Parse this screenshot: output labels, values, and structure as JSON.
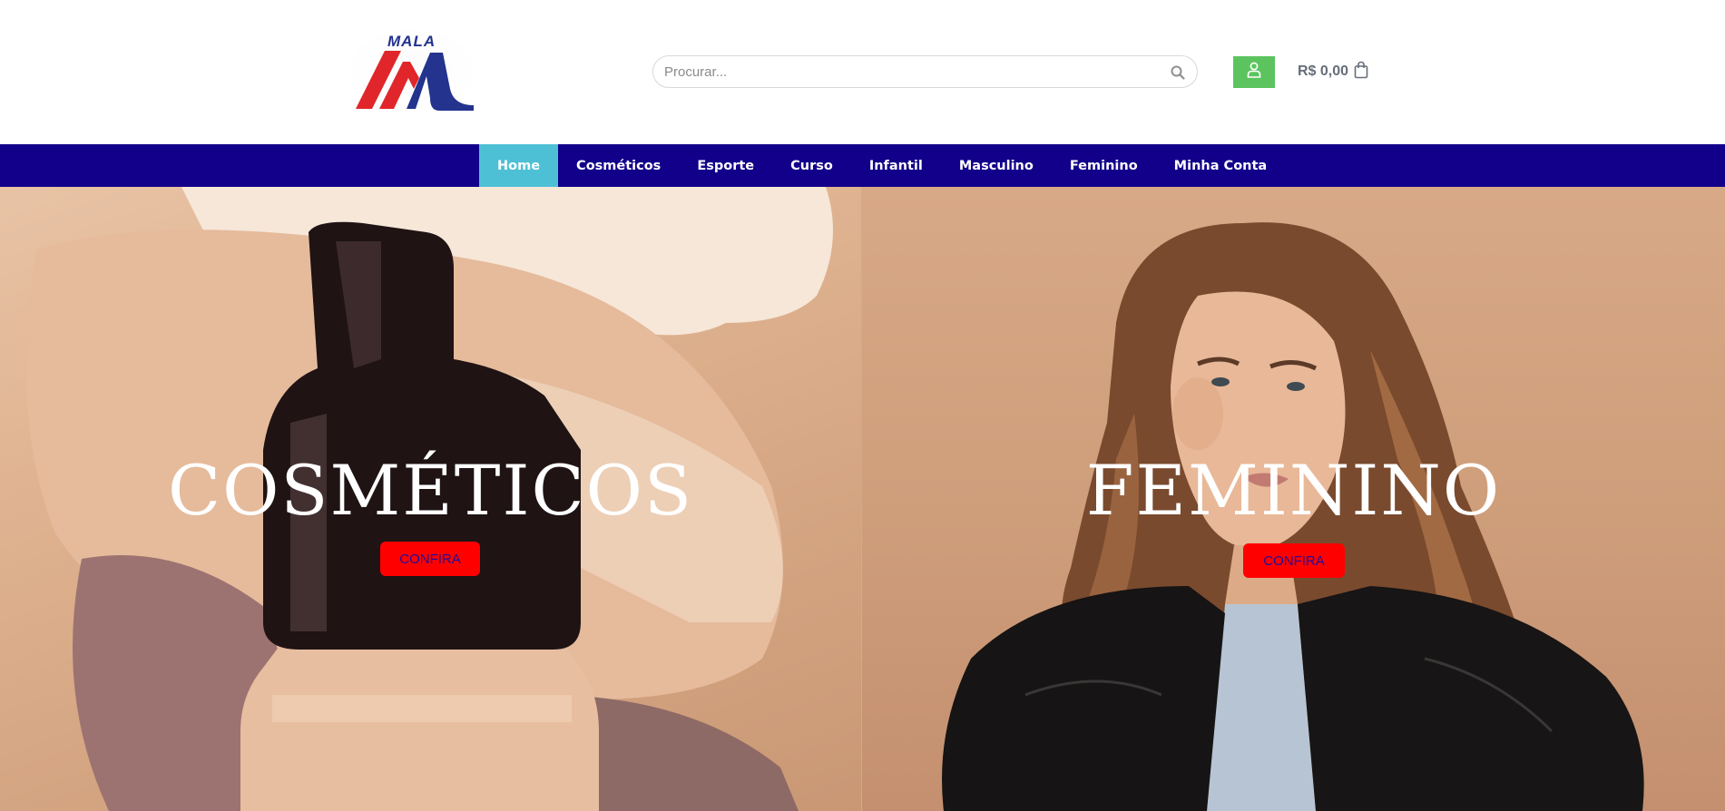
{
  "header": {
    "logo_text": "MALA",
    "search": {
      "placeholder": "Procurar..."
    },
    "cart_total": "R$ 0,00"
  },
  "nav": {
    "items": [
      {
        "label": "Home"
      },
      {
        "label": "Cosméticos"
      },
      {
        "label": "Esporte"
      },
      {
        "label": "Curso"
      },
      {
        "label": "Infantil"
      },
      {
        "label": "Masculino"
      },
      {
        "label": "Feminino"
      },
      {
        "label": "Minha Conta"
      }
    ]
  },
  "banners": {
    "left": {
      "title": "COSMÉTICOS",
      "button": "CONFIRA"
    },
    "right": {
      "title": "FEMININO",
      "button": "CONFIRA"
    }
  },
  "colors": {
    "nav_bg": "#12008a",
    "nav_active": "#4ec0d5",
    "account_green": "#5cc45f",
    "button_red": "#ff0000",
    "button_text": "#1a0ea0",
    "logo_red": "#e0262a",
    "logo_blue": "#23338e"
  },
  "icons": {
    "search": "search-icon",
    "account": "user-icon",
    "cart": "shopping-bag-icon"
  }
}
